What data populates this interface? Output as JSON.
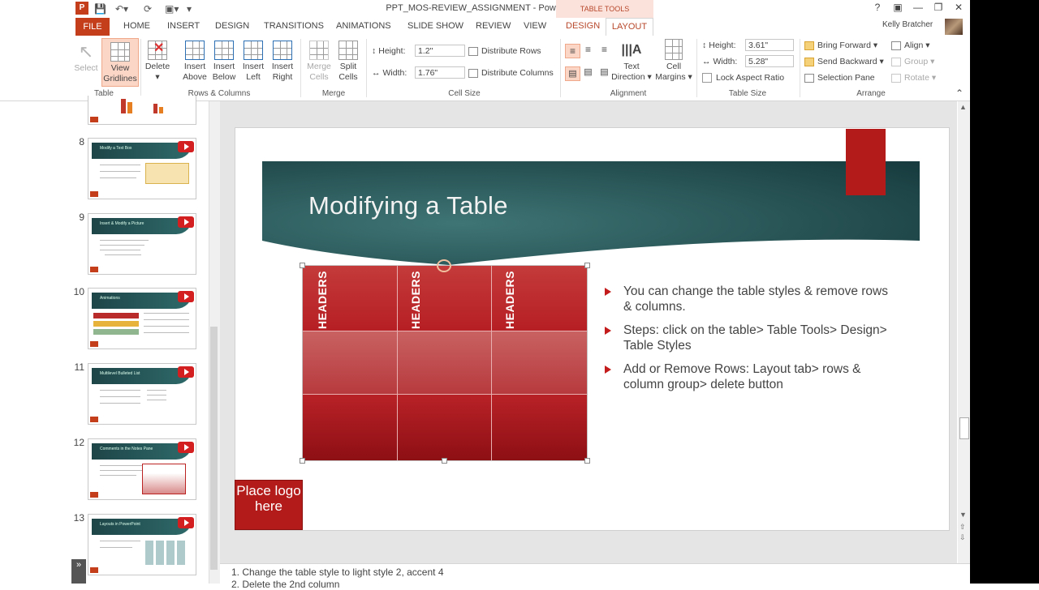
{
  "window": {
    "title": "PPT_MOS-REVIEW_ASSIGNMENT - PowerPoint",
    "app_icon": "P",
    "context_tab_group": "TABLE TOOLS",
    "help": "?",
    "user_name": "Kelly Bratcher"
  },
  "tabs": {
    "file": "FILE",
    "items": [
      "HOME",
      "INSERT",
      "DESIGN",
      "TRANSITIONS",
      "ANIMATIONS",
      "SLIDE SHOW",
      "REVIEW",
      "VIEW"
    ],
    "context_design": "DESIGN",
    "context_layout": "LAYOUT"
  },
  "ribbon": {
    "table_group": {
      "label": "Table",
      "select": "Select",
      "view_gridlines_1": "View",
      "view_gridlines_2": "Gridlines"
    },
    "rows_columns_group": {
      "label": "Rows & Columns",
      "delete": "Delete",
      "insert_above_1": "Insert",
      "insert_above_2": "Above",
      "insert_below_1": "Insert",
      "insert_below_2": "Below",
      "insert_left_1": "Insert",
      "insert_left_2": "Left",
      "insert_right_1": "Insert",
      "insert_right_2": "Right"
    },
    "merge_group": {
      "label": "Merge",
      "merge_1": "Merge",
      "merge_2": "Cells",
      "split_1": "Split",
      "split_2": "Cells"
    },
    "cell_size_group": {
      "label": "Cell Size",
      "height_label": "Height:",
      "height_value": "1.2\"",
      "width_label": "Width:",
      "width_value": "1.76\"",
      "distribute_rows": "Distribute Rows",
      "distribute_columns": "Distribute Columns"
    },
    "alignment_group": {
      "label": "Alignment",
      "text_direction_1": "Text",
      "text_direction_2": "Direction",
      "cell_margins_1": "Cell",
      "cell_margins_2": "Margins"
    },
    "table_size_group": {
      "label": "Table Size",
      "height_label": "Height:",
      "height_value": "3.61\"",
      "width_label": "Width:",
      "width_value": "5.28\"",
      "lock_aspect": "Lock Aspect Ratio"
    },
    "arrange_group": {
      "label": "Arrange",
      "bring_forward": "Bring Forward",
      "send_backward": "Send Backward",
      "selection_pane": "Selection Pane",
      "align": "Align",
      "group": "Group",
      "rotate": "Rotate"
    }
  },
  "thumbnails": [
    {
      "num": "8",
      "title": "Modify a Text Box"
    },
    {
      "num": "9",
      "title": "Insert & Modify a Picture"
    },
    {
      "num": "10",
      "title": "Animations"
    },
    {
      "num": "11",
      "title": "Multilevel Bulleted List"
    },
    {
      "num": "12",
      "title": "Comments in the Notes Pane"
    },
    {
      "num": "13",
      "title": "Layouts in PowerPoint"
    }
  ],
  "slide": {
    "title": "Modifying a Table",
    "headers": [
      "HEADERS",
      "HEADERS",
      "HEADERS"
    ],
    "bullets": [
      "You can change the table styles & remove rows & columns.",
      "Steps: click on the table> Table Tools> Design> Table Styles",
      "Add or Remove Rows: Layout tab> rows & column group> delete button"
    ],
    "logo_placeholder": "Place logo here"
  },
  "notes": {
    "line1": "1.   Change the table style to light style 2, accent 4",
    "line2": "2.   Delete the 2nd column"
  },
  "colors": {
    "accent": "#c43e1c",
    "banner_dark": "#1d4547",
    "table_red": "#b81d22"
  }
}
